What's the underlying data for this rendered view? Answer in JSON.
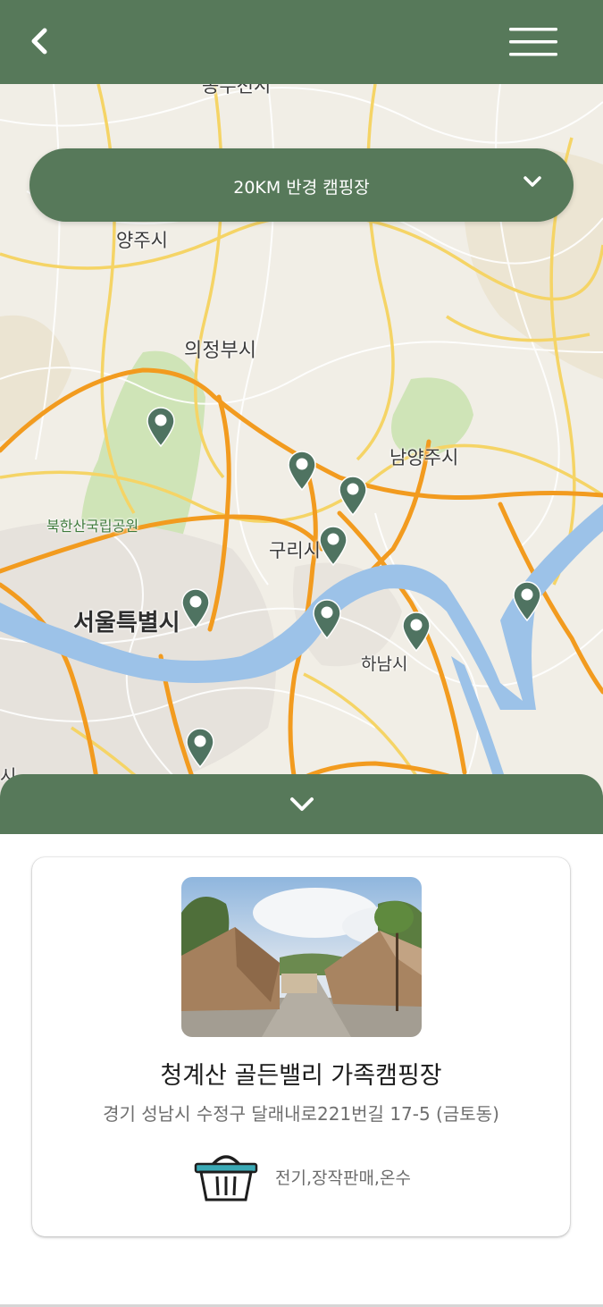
{
  "header": {
    "back_icon": "chevron-left-icon",
    "menu_icon": "hamburger-menu-icon"
  },
  "map": {
    "labels": {
      "top_cut": "동두천시",
      "yangju": "양주시",
      "uijeongbu": "의정부시",
      "namyangju": "남양주시",
      "bukhansan": "북한산국립공원",
      "guri": "구리시",
      "seoul": "서울특별시",
      "hanam": "하남시",
      "left_cut": "시"
    },
    "pin_icon": "map-pin-icon",
    "pin_color": "#4f7361"
  },
  "radius_selector": {
    "label": "20KM 반경 캠핑장",
    "icon": "chevron-down-icon"
  },
  "sheet": {
    "toggle_icon": "chevron-down-icon"
  },
  "campsite": {
    "name": "청계산 골든밸리 가족캠핑장",
    "address": "경기 성남시 수정구 달래내로221번길 17-5 (금토동)",
    "amenities": "전기,장작판매,온수",
    "amenity_icon": "basket-icon"
  },
  "colors": {
    "brand_green": "#57795a",
    "basket_teal": "#3aa9b5"
  }
}
